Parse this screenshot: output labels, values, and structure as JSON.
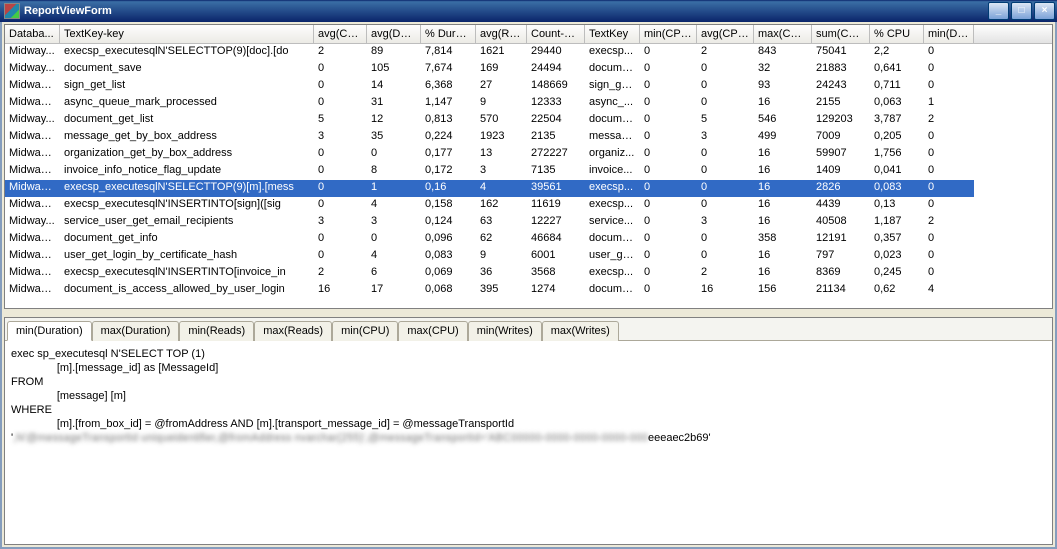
{
  "window": {
    "title": "ReportViewForm"
  },
  "columns": [
    "Databa...",
    "TextKey-key",
    "avg(CP...",
    "avg(Dur...",
    "% Durati...",
    "avg(Re...",
    "Count-key",
    "TextKey",
    "min(CPU)",
    "avg(CPU)",
    "max(CPU)",
    "sum(CPU)",
    "% CPU",
    "min(Dur..."
  ],
  "rows": [
    {
      "db": "Midway...",
      "textkeykey": "execsp_executesqlN'SELECTTOP(9)[doc].[do",
      "avgcp": "2",
      "avgdur": "89",
      "pdur": "7,814",
      "avgre": "1621",
      "count": "29440",
      "textkey": "execsp...",
      "mincpu": "0",
      "avgcpu": "2",
      "maxcpu": "843",
      "sumcpu": "75041",
      "pcpu": "2,2",
      "mindur": "0"
    },
    {
      "db": "Midway...",
      "textkeykey": "document_save",
      "avgcp": "0",
      "avgdur": "105",
      "pdur": "7,674",
      "avgre": "169",
      "count": "24494",
      "textkey": "docume...",
      "mincpu": "0",
      "avgcpu": "0",
      "maxcpu": "32",
      "sumcpu": "21883",
      "pcpu": "0,641",
      "mindur": "0"
    },
    {
      "db": "MidwayE...",
      "textkeykey": "sign_get_list",
      "avgcp": "0",
      "avgdur": "14",
      "pdur": "6,368",
      "avgre": "27",
      "count": "148669",
      "textkey": "sign_ge...",
      "mincpu": "0",
      "avgcpu": "0",
      "maxcpu": "93",
      "sumcpu": "24243",
      "pcpu": "0,711",
      "mindur": "0"
    },
    {
      "db": "MidwayE...",
      "textkeykey": "async_queue_mark_processed",
      "avgcp": "0",
      "avgdur": "31",
      "pdur": "1,147",
      "avgre": "9",
      "count": "12333",
      "textkey": "async_...",
      "mincpu": "0",
      "avgcpu": "0",
      "maxcpu": "16",
      "sumcpu": "2155",
      "pcpu": "0,063",
      "mindur": "1"
    },
    {
      "db": "Midway...",
      "textkeykey": "document_get_list",
      "avgcp": "5",
      "avgdur": "12",
      "pdur": "0,813",
      "avgre": "570",
      "count": "22504",
      "textkey": "docume...",
      "mincpu": "0",
      "avgcpu": "5",
      "maxcpu": "546",
      "sumcpu": "129203",
      "pcpu": "3,787",
      "mindur": "2"
    },
    {
      "db": "MidwayE...",
      "textkeykey": "message_get_by_box_address",
      "avgcp": "3",
      "avgdur": "35",
      "pdur": "0,224",
      "avgre": "1923",
      "count": "2135",
      "textkey": "messag...",
      "mincpu": "0",
      "avgcpu": "3",
      "maxcpu": "499",
      "sumcpu": "7009",
      "pcpu": "0,205",
      "mindur": "0"
    },
    {
      "db": "MidwayE...",
      "textkeykey": "organization_get_by_box_address",
      "avgcp": "0",
      "avgdur": "0",
      "pdur": "0,177",
      "avgre": "13",
      "count": "272227",
      "textkey": "organiz...",
      "mincpu": "0",
      "avgcpu": "0",
      "maxcpu": "16",
      "sumcpu": "59907",
      "pcpu": "1,756",
      "mindur": "0"
    },
    {
      "db": "MidwayE...",
      "textkeykey": "invoice_info_notice_flag_update",
      "avgcp": "0",
      "avgdur": "8",
      "pdur": "0,172",
      "avgre": "3",
      "count": "7135",
      "textkey": "invoice...",
      "mincpu": "0",
      "avgcpu": "0",
      "maxcpu": "16",
      "sumcpu": "1409",
      "pcpu": "0,041",
      "mindur": "0"
    },
    {
      "db": "MidwayE...",
      "textkeykey": "execsp_executesqlN'SELECTTOP(9)[m].[mess",
      "avgcp": "0",
      "avgdur": "1",
      "pdur": "0,16",
      "avgre": "4",
      "count": "39561",
      "textkey": "execsp...",
      "mincpu": "0",
      "avgcpu": "0",
      "maxcpu": "16",
      "sumcpu": "2826",
      "pcpu": "0,083",
      "mindur": "0",
      "selected": true
    },
    {
      "db": "MidwayE...",
      "textkeykey": "execsp_executesqlN'INSERTINTO[sign]([sig",
      "avgcp": "0",
      "avgdur": "4",
      "pdur": "0,158",
      "avgre": "162",
      "count": "11619",
      "textkey": "execsp...",
      "mincpu": "0",
      "avgcpu": "0",
      "maxcpu": "16",
      "sumcpu": "4439",
      "pcpu": "0,13",
      "mindur": "0"
    },
    {
      "db": "Midway...",
      "textkeykey": "service_user_get_email_recipients",
      "avgcp": "3",
      "avgdur": "3",
      "pdur": "0,124",
      "avgre": "63",
      "count": "12227",
      "textkey": "service...",
      "mincpu": "0",
      "avgcpu": "3",
      "maxcpu": "16",
      "sumcpu": "40508",
      "pcpu": "1,187",
      "mindur": "2"
    },
    {
      "db": "MidwayE...",
      "textkeykey": "document_get_info",
      "avgcp": "0",
      "avgdur": "0",
      "pdur": "0,096",
      "avgre": "62",
      "count": "46684",
      "textkey": "docume...",
      "mincpu": "0",
      "avgcpu": "0",
      "maxcpu": "358",
      "sumcpu": "12191",
      "pcpu": "0,357",
      "mindur": "0"
    },
    {
      "db": "MidwayE...",
      "textkeykey": "user_get_login_by_certificate_hash",
      "avgcp": "0",
      "avgdur": "4",
      "pdur": "0,083",
      "avgre": "9",
      "count": "6001",
      "textkey": "user_ge...",
      "mincpu": "0",
      "avgcpu": "0",
      "maxcpu": "16",
      "sumcpu": "797",
      "pcpu": "0,023",
      "mindur": "0"
    },
    {
      "db": "MidwayE...",
      "textkeykey": "execsp_executesqlN'INSERTINTO[invoice_in",
      "avgcp": "2",
      "avgdur": "6",
      "pdur": "0,069",
      "avgre": "36",
      "count": "3568",
      "textkey": "execsp...",
      "mincpu": "0",
      "avgcpu": "2",
      "maxcpu": "16",
      "sumcpu": "8369",
      "pcpu": "0,245",
      "mindur": "0"
    },
    {
      "db": "MidwayE...",
      "textkeykey": "document_is_access_allowed_by_user_login",
      "avgcp": "16",
      "avgdur": "17",
      "pdur": "0,068",
      "avgre": "395",
      "count": "1274",
      "textkey": "docume...",
      "mincpu": "0",
      "avgcpu": "16",
      "maxcpu": "156",
      "sumcpu": "21134",
      "pcpu": "0,62",
      "mindur": "4"
    }
  ],
  "tabs": [
    "min(Duration)",
    "max(Duration)",
    "min(Reads)",
    "max(Reads)",
    "min(CPU)",
    "max(CPU)",
    "min(Writes)",
    "max(Writes)"
  ],
  "activeTab": 0,
  "sql": {
    "line1": "exec sp_executesql N'SELECT TOP (1)",
    "line2": "               [m].[message_id] as [MessageId]",
    "line3": "FROM",
    "line4": "               [message] [m]",
    "line5": "WHERE",
    "line6": "               [m].[from_box_id] = @fromAddress AND [m].[transport_message_id] = @messageTransportId",
    "line7blur": ",N'@messageTransportId uniqueidentifier,@fromAddress nvarchar(255)',@messageTransportId='ABC00000-0000-0000-0000-000",
    "line7suffix": "eeeaec2b69'"
  }
}
